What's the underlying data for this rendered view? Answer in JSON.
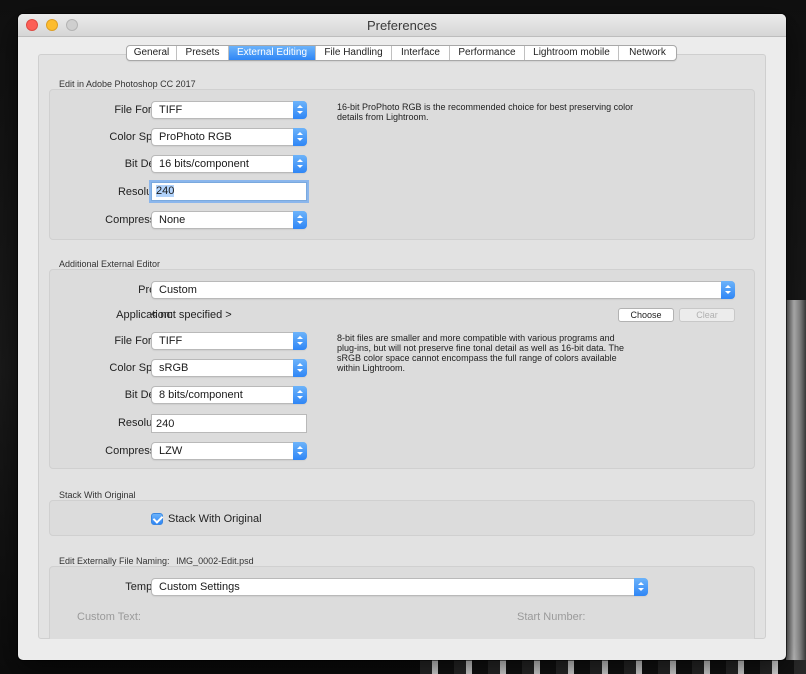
{
  "window": {
    "title": "Preferences"
  },
  "tabs": [
    {
      "label": "General",
      "active": false
    },
    {
      "label": "Presets",
      "active": false
    },
    {
      "label": "External Editing",
      "active": true
    },
    {
      "label": "File Handling",
      "active": false
    },
    {
      "label": "Interface",
      "active": false
    },
    {
      "label": "Performance",
      "active": false
    },
    {
      "label": "Lightroom mobile",
      "active": false
    },
    {
      "label": "Network",
      "active": false
    }
  ],
  "photoshop": {
    "section_title": "Edit in Adobe Photoshop CC 2017",
    "file_format_label": "File Format:",
    "file_format": "TIFF",
    "color_space_label": "Color Space:",
    "color_space": "ProPhoto RGB",
    "bit_depth_label": "Bit Depth:",
    "bit_depth": "16 bits/component",
    "resolution_label": "Resolution:",
    "resolution": "240",
    "compression_label": "Compression:",
    "compression": "None",
    "note": "16-bit ProPhoto RGB is the recommended choice for best preserving color details from Lightroom."
  },
  "external": {
    "section_title": "Additional External Editor",
    "preset_label": "Preset:",
    "preset": "Custom",
    "application_label": "Application:",
    "application": "< not specified >",
    "choose_label": "Choose",
    "clear_label": "Clear",
    "file_format_label": "File Format:",
    "file_format": "TIFF",
    "color_space_label": "Color Space:",
    "color_space": "sRGB",
    "bit_depth_label": "Bit Depth:",
    "bit_depth": "8 bits/component",
    "resolution_label": "Resolution:",
    "resolution": "240",
    "compression_label": "Compression:",
    "compression": "LZW",
    "note": "8-bit files are smaller and more compatible with various programs and plug-ins, but will not preserve fine tonal detail as well as 16-bit data. The sRGB color space cannot encompass the full range of colors available within Lightroom."
  },
  "stack": {
    "section_title": "Stack With Original",
    "checkbox_label": "Stack With Original",
    "checked": true
  },
  "naming": {
    "section_title": "Edit Externally File Naming:",
    "example": "IMG_0002-Edit.psd",
    "template_label": "Template:",
    "template": "Custom Settings",
    "custom_text_label": "Custom Text:",
    "start_number_label": "Start Number:"
  },
  "colors": {
    "accent": "#2f86f6",
    "close": "#fc5f57",
    "minimize": "#fdbc2e",
    "zoom_disabled": "#cfcfcf"
  },
  "icons": [
    "close-icon",
    "minimize-icon",
    "zoom-icon",
    "popup-arrows-icon",
    "checkmark-icon"
  ]
}
